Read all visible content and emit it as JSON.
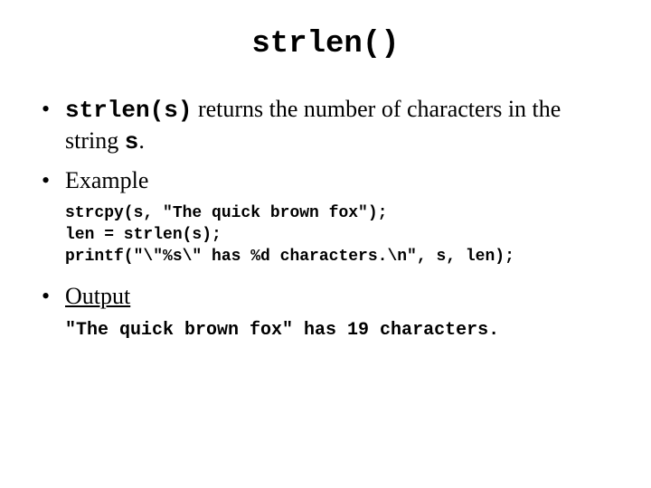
{
  "title": "strlen()",
  "bullet1": {
    "code": "strlen(s)",
    "mid": " returns the number of characters in the string ",
    "var": "s",
    "end": "."
  },
  "example_label": "Example",
  "code": "strcpy(s, \"The quick brown fox\");\nlen = strlen(s);\nprintf(\"\\\"%s\\\" has %d characters.\\n\", s, len);",
  "output_label": "Output",
  "output": "\"The quick brown fox\" has 19 characters."
}
